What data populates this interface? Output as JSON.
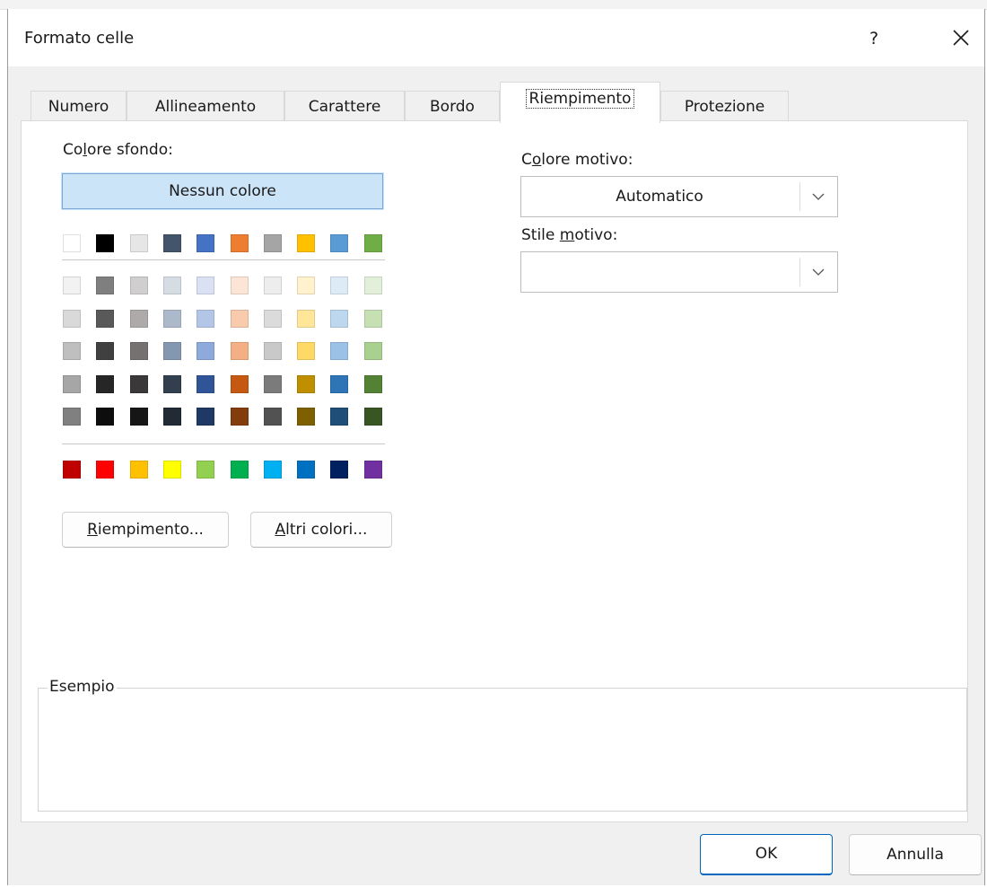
{
  "dialog": {
    "title": "Formato celle",
    "help_label": "?"
  },
  "tabs": [
    {
      "label": "Numero"
    },
    {
      "label": "Allineamento"
    },
    {
      "label": "Carattere"
    },
    {
      "label": "Bordo"
    },
    {
      "label": "Riempimento",
      "active": true
    },
    {
      "label": "Protezione"
    }
  ],
  "background": {
    "label_a": "Co",
    "label_key": "l",
    "label_b": "ore sfondo:",
    "no_color_label": "Nessun colore",
    "base_colors": [
      "#ffffff",
      "#000000",
      "#e7e6e6",
      "#44546a",
      "#4472c4",
      "#ed7d31",
      "#a5a5a5",
      "#ffc000",
      "#5b9bd5",
      "#70ad47"
    ],
    "tint_rows": [
      [
        "#f2f2f2",
        "#7f7f7f",
        "#d0cece",
        "#d6dce4",
        "#d9e1f2",
        "#fce4d6",
        "#ededed",
        "#fff2cc",
        "#ddebf7",
        "#e2efda"
      ],
      [
        "#d9d9d9",
        "#595959",
        "#aeaaaa",
        "#acb9ca",
        "#b4c6e7",
        "#f8cbad",
        "#dbdbdb",
        "#ffe699",
        "#bdd7ee",
        "#c6e0b4"
      ],
      [
        "#bfbfbf",
        "#404040",
        "#757171",
        "#8497b0",
        "#8ea9db",
        "#f4b084",
        "#c9c9c9",
        "#ffd966",
        "#9bc2e6",
        "#a9d08e"
      ],
      [
        "#a6a6a6",
        "#262626",
        "#3a3838",
        "#333f4f",
        "#2f5597",
        "#c65911",
        "#7b7b7b",
        "#bf8f00",
        "#2e75b6",
        "#548235"
      ],
      [
        "#808080",
        "#0d0d0d",
        "#161616",
        "#222b35",
        "#1f3864",
        "#833c0c",
        "#525252",
        "#7f6000",
        "#1f4e78",
        "#375623"
      ]
    ],
    "standard_colors": [
      "#c00000",
      "#ff0000",
      "#ffc000",
      "#ffff00",
      "#92d050",
      "#00b050",
      "#00b0f0",
      "#0070c0",
      "#002060",
      "#7030a0"
    ],
    "fill_effects_key": "R",
    "fill_effects_rest": "iempimento...",
    "more_colors_key": "A",
    "more_colors_rest": "ltri colori..."
  },
  "pattern": {
    "color_label_a": "C",
    "color_label_key": "o",
    "color_label_b": "lore motivo:",
    "color_value": "Automatico",
    "style_label_a": "Stile ",
    "style_label_key": "m",
    "style_label_b": "otivo:",
    "style_value": ""
  },
  "sample": {
    "label": "Esempio"
  },
  "footer": {
    "ok_label": "OK",
    "cancel_label": "Annulla"
  },
  "icons": {
    "close": "close-icon",
    "dropdown": "chevron-down-icon"
  }
}
